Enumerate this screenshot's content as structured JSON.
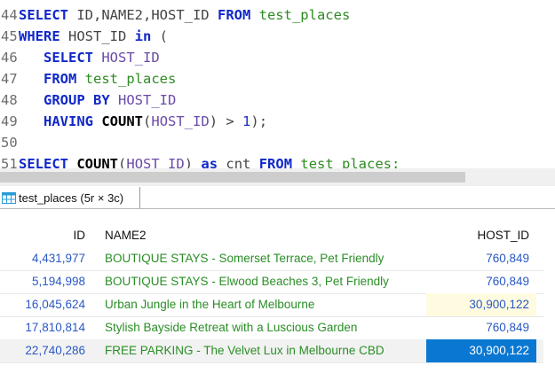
{
  "editor": {
    "lines": [
      {
        "num": "44",
        "tokens": [
          {
            "t": "SELECT",
            "c": "kw"
          },
          {
            "t": " ID,NAME2,HOST_ID ",
            "c": "id"
          },
          {
            "t": "FROM",
            "c": "kw"
          },
          {
            "t": " test_places",
            "c": "tbl"
          }
        ]
      },
      {
        "num": "45",
        "tokens": [
          {
            "t": "WHERE",
            "c": "kw"
          },
          {
            "t": " HOST_ID ",
            "c": "id"
          },
          {
            "t": "in",
            "c": "kw"
          },
          {
            "t": " (",
            "c": "op"
          }
        ]
      },
      {
        "num": "46",
        "tokens": [
          {
            "t": "   "
          },
          {
            "t": "SELECT",
            "c": "kw"
          },
          {
            "t": " HOST_ID",
            "c": "col"
          }
        ]
      },
      {
        "num": "47",
        "tokens": [
          {
            "t": "   "
          },
          {
            "t": "FROM",
            "c": "kw"
          },
          {
            "t": " test_places",
            "c": "tbl"
          }
        ]
      },
      {
        "num": "48",
        "tokens": [
          {
            "t": "   "
          },
          {
            "t": "GROUP BY",
            "c": "kw"
          },
          {
            "t": " HOST_ID",
            "c": "col"
          }
        ]
      },
      {
        "num": "49",
        "tokens": [
          {
            "t": "   "
          },
          {
            "t": "HAVING",
            "c": "kw"
          },
          {
            "t": " "
          },
          {
            "t": "COUNT",
            "c": "fn"
          },
          {
            "t": "(",
            "c": "op"
          },
          {
            "t": "HOST_ID",
            "c": "col"
          },
          {
            "t": ") > ",
            "c": "op"
          },
          {
            "t": "1",
            "c": "num"
          },
          {
            "t": ");",
            "c": "op"
          }
        ]
      },
      {
        "num": "50",
        "tokens": []
      },
      {
        "num": "51",
        "tokens": [
          {
            "t": "SELECT",
            "c": "kw"
          },
          {
            "t": " "
          },
          {
            "t": "COUNT",
            "c": "fn"
          },
          {
            "t": "(",
            "c": "op"
          },
          {
            "t": "HOST_ID",
            "c": "col"
          },
          {
            "t": ") ",
            "c": "op"
          },
          {
            "t": "as",
            "c": "kw"
          },
          {
            "t": " cnt ",
            "c": "id"
          },
          {
            "t": "FROM",
            "c": "kw"
          },
          {
            "t": " test_places;",
            "c": "tbl"
          }
        ]
      }
    ]
  },
  "result_tab": {
    "label": "test_places (5r × 3c)",
    "icon": "table-grid-icon"
  },
  "grid": {
    "headers": {
      "id": "ID",
      "name": "NAME2",
      "host": "HOST_ID"
    },
    "rows": [
      {
        "id": "4,431,977",
        "name": "BOUTIQUE STAYS - Somerset Terrace, Pet Friendly",
        "host": "760,849"
      },
      {
        "id": "5,194,998",
        "name": "BOUTIQUE STAYS - Elwood Beaches 3, Pet Friendly",
        "host": "760,849"
      },
      {
        "id": "16,045,624",
        "name": "Urban Jungle in the Heart of Melbourne",
        "host": "30,900,122"
      },
      {
        "id": "17,810,814",
        "name": "Stylish Bayside Retreat with a Luscious Garden",
        "host": "760,849"
      },
      {
        "id": "22,740,286",
        "name": "FREE PARKING - The Velvet Lux in Melbourne CBD",
        "host": "30,900,122"
      }
    ],
    "highlighted_cell": {
      "row": 2,
      "col": "host"
    },
    "selected_cell": {
      "row": 4,
      "col": "host"
    }
  },
  "colors": {
    "keyword": "#1028c8",
    "table_name": "#2e8b22",
    "column": "#6a4aa8",
    "number_cell": "#2a58c4",
    "text_cell": "#2a8e26",
    "selection": "#0a78d2",
    "highlight": "#fffbe1"
  }
}
